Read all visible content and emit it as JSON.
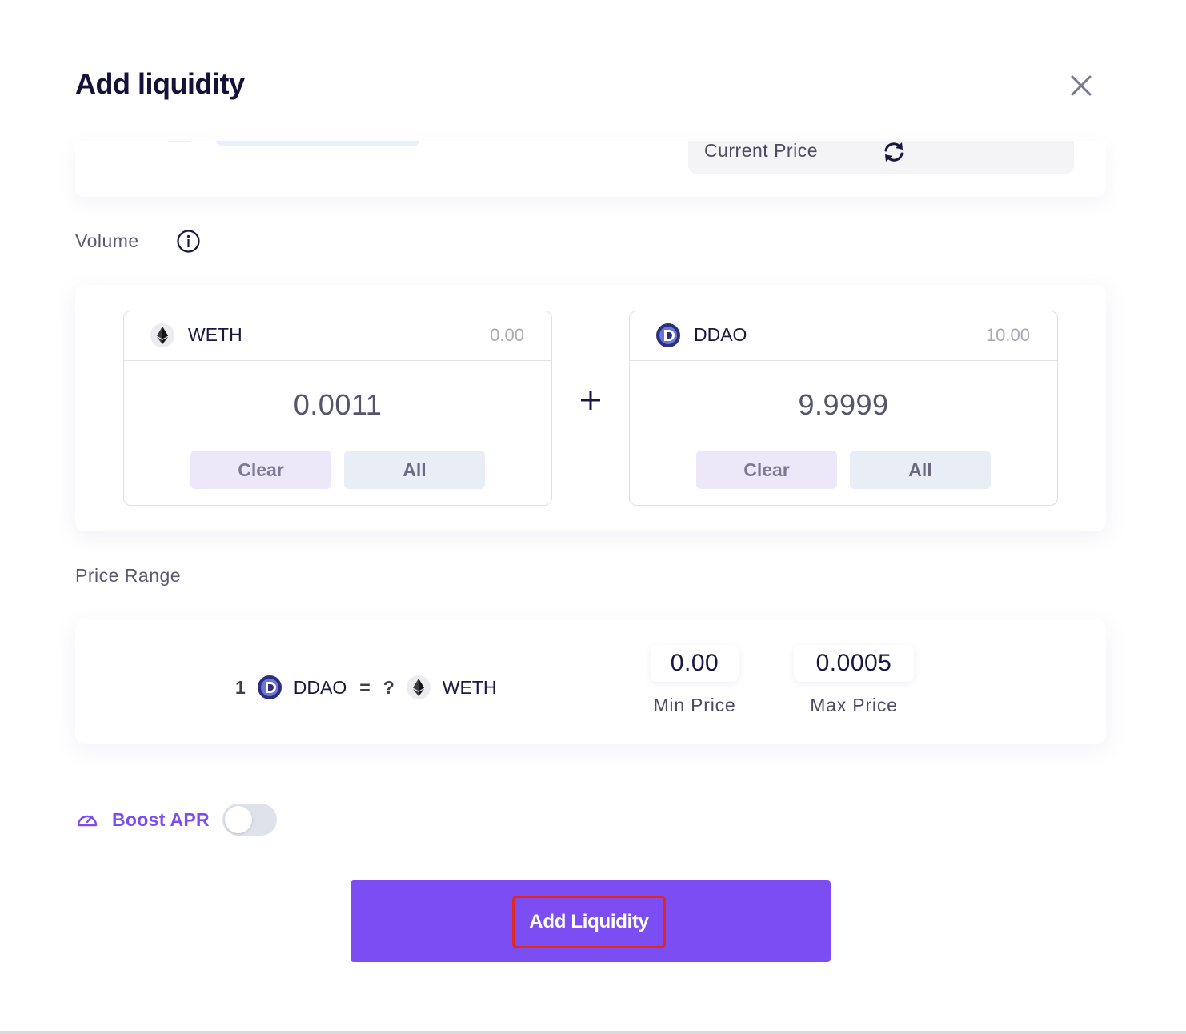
{
  "modal": {
    "title": "Add liquidity"
  },
  "top": {
    "current_price_label": "Current Price"
  },
  "volume": {
    "label": "Volume",
    "tokens": [
      {
        "name": "WETH",
        "balance": "0.00",
        "amount": "0.0011",
        "clear_label": "Clear",
        "all_label": "All",
        "icon": "ethereum-icon"
      },
      {
        "name": "DDAO",
        "balance": "10.00",
        "amount": "9.9999",
        "clear_label": "Clear",
        "all_label": "All",
        "icon": "ddao-icon"
      }
    ]
  },
  "price_range": {
    "label": "Price Range",
    "rate": {
      "quantity": "1",
      "base": "DDAO",
      "equals": "=",
      "unknown": "?",
      "quote": "WETH"
    },
    "min_value": "0.00",
    "min_label": "Min Price",
    "max_value": "0.0005",
    "max_label": "Max Price"
  },
  "boost": {
    "label": "Boost APR",
    "enabled": false
  },
  "submit": {
    "label": "Add Liquidity"
  },
  "colors": {
    "accent": "#7b4df2",
    "highlight_border": "#e0281c",
    "title": "#14123a"
  }
}
